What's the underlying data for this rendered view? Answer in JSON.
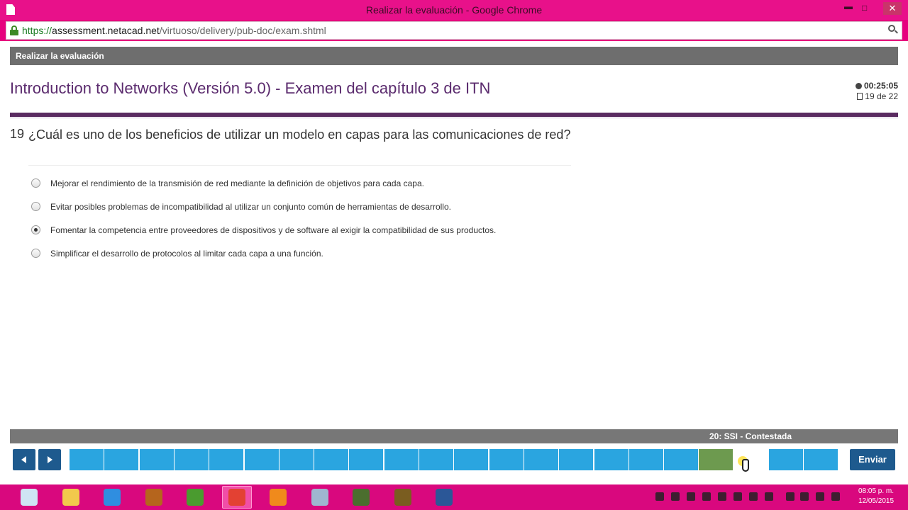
{
  "window": {
    "title": "Realizar la evaluación - Google Chrome",
    "controls": {
      "minimize": "▬",
      "maximize": "□",
      "close": "✕"
    }
  },
  "address_bar": {
    "scheme": "https://",
    "host": "assessment.netacad.net",
    "path": "/virtuoso/delivery/pub-doc/exam.shtml"
  },
  "page": {
    "header_band": "Realizar la evaluación",
    "exam_title": "Introduction to Networks (Versión 5.0) - Examen del capítulo 3 de ITN",
    "timer": "00:25:05",
    "progress": "19 de 22",
    "question": {
      "number": "19",
      "text": "¿Cuál es uno de los beneficios de utilizar un modelo en capas para las comunicaciones de red?",
      "selected_index": 2,
      "options": [
        "Mejorar el rendimiento de la transmisión de red mediante la definición de objetivos para cada capa.",
        "Evitar posibles problemas de incompatibilidad al utilizar un conjunto común de herramientas de desarrollo.",
        "Fomentar la competencia entre proveedores de dispositivos y de software al exigir la compatibilidad de sus productos.",
        "Simplificar el desarrollo de protocolos al limitar cada capa a una función."
      ]
    },
    "status_text": "20: SSI - Contestada",
    "submit_label": "Enviar",
    "nav": {
      "question_count": 22,
      "answered_box": 18,
      "hovered_box": 19
    }
  },
  "colors": {
    "window_chrome": "#e6007e",
    "exam_title": "#5b2b6e",
    "rule": "#5a2b61",
    "nav_button": "#1e5a8e",
    "question_box": "#2aa5e0",
    "answered_box": "#6d9a4f"
  },
  "taskbar": {
    "apps": [
      {
        "name": "settings-app",
        "color": "#cfe4f4"
      },
      {
        "name": "file-explorer",
        "color": "#f2c94c"
      },
      {
        "name": "internet-explorer",
        "color": "#2f8ee0"
      },
      {
        "name": "baseball-glove-app",
        "color": "#b5651d"
      },
      {
        "name": "python-app",
        "color": "#4a9b2f"
      },
      {
        "name": "google-chrome",
        "color": "#e34133"
      },
      {
        "name": "firefox",
        "color": "#f08a1c"
      },
      {
        "name": "virtualbox",
        "color": "#9fb6d0"
      },
      {
        "name": "packet-tracer",
        "color": "#4b6e2e"
      },
      {
        "name": "utility-app",
        "color": "#7a5d20"
      },
      {
        "name": "microsoft-word",
        "color": "#2b5797"
      }
    ],
    "active_app": 5,
    "clock": {
      "time": "08:05 p. m.",
      "date": "12/05/2015"
    }
  }
}
